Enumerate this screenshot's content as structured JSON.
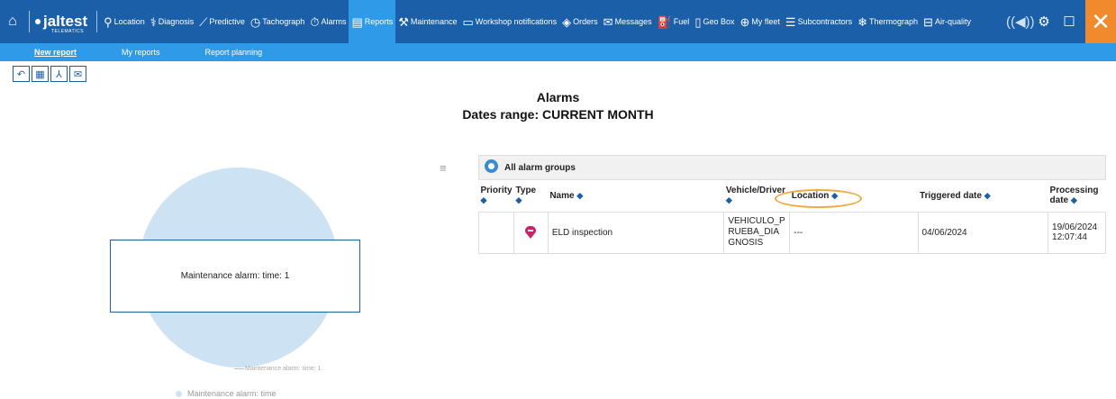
{
  "nav": {
    "items": [
      {
        "label": "Location",
        "icon": "pin-icon",
        "glyph": "⚲"
      },
      {
        "label": "Diagnosis",
        "icon": "diagnosis-icon",
        "glyph": "⚕"
      },
      {
        "label": "Predictive",
        "icon": "predictive-icon",
        "glyph": "⟋"
      },
      {
        "label": "Tachograph",
        "icon": "tachograph-icon",
        "glyph": "◷"
      },
      {
        "label": "Alarms",
        "icon": "alarm-clock-icon",
        "glyph": "⏱"
      },
      {
        "label": "Reports",
        "icon": "report-icon",
        "glyph": "▤"
      },
      {
        "label": "Maintenance",
        "icon": "wrench-icon",
        "glyph": "⚒"
      },
      {
        "label": "Workshop notifications",
        "icon": "folder-icon",
        "glyph": "▭"
      },
      {
        "label": "Orders",
        "icon": "cube-icon",
        "glyph": "◈"
      },
      {
        "label": "Messages",
        "icon": "envelope-icon",
        "glyph": "✉"
      },
      {
        "label": "Fuel",
        "icon": "fuel-icon",
        "glyph": "⛽"
      },
      {
        "label": "Geo Box",
        "icon": "geobox-icon",
        "glyph": "▯"
      },
      {
        "label": "My fleet",
        "icon": "fleet-icon",
        "glyph": "⊕"
      },
      {
        "label": "Subcontractors",
        "icon": "list-icon",
        "glyph": "☰"
      },
      {
        "label": "Thermograph",
        "icon": "snowflake-icon",
        "glyph": "❄"
      },
      {
        "label": "Air-quality",
        "icon": "air-quality-icon",
        "glyph": "⊟"
      }
    ],
    "active_index": 5
  },
  "logo": {
    "text": "jaltest",
    "sub": "TELEMATICS"
  },
  "subnav": {
    "new_report": "New report",
    "my_reports": "My reports",
    "report_planning": "Report planning"
  },
  "report": {
    "title": "Alarms",
    "subtitle": "Dates range: CURRENT MONTH"
  },
  "chart_data": {
    "type": "pie",
    "slices": [
      {
        "label": "Maintenance alarm: time",
        "value": 1
      }
    ],
    "tooltip": "Maintenance alarm: time: 1",
    "data_label": "Maintenance alarm: time: 1",
    "legend": [
      "Maintenance alarm: time"
    ]
  },
  "table": {
    "group": "All alarm groups",
    "headers": [
      "Priority",
      "Type",
      "Name",
      "Vehicle/Driver",
      "Location",
      "Triggered date",
      "Processing date"
    ],
    "rows": [
      {
        "priority": "",
        "type": "alarm-marker-icon",
        "name": "ELD inspection",
        "vehicle": "VEHICULO_PRUEBA_DIAGNOSIS",
        "location": "---",
        "triggered": "04/06/2024",
        "processing": "19/06/2024 12:07:44"
      }
    ]
  }
}
